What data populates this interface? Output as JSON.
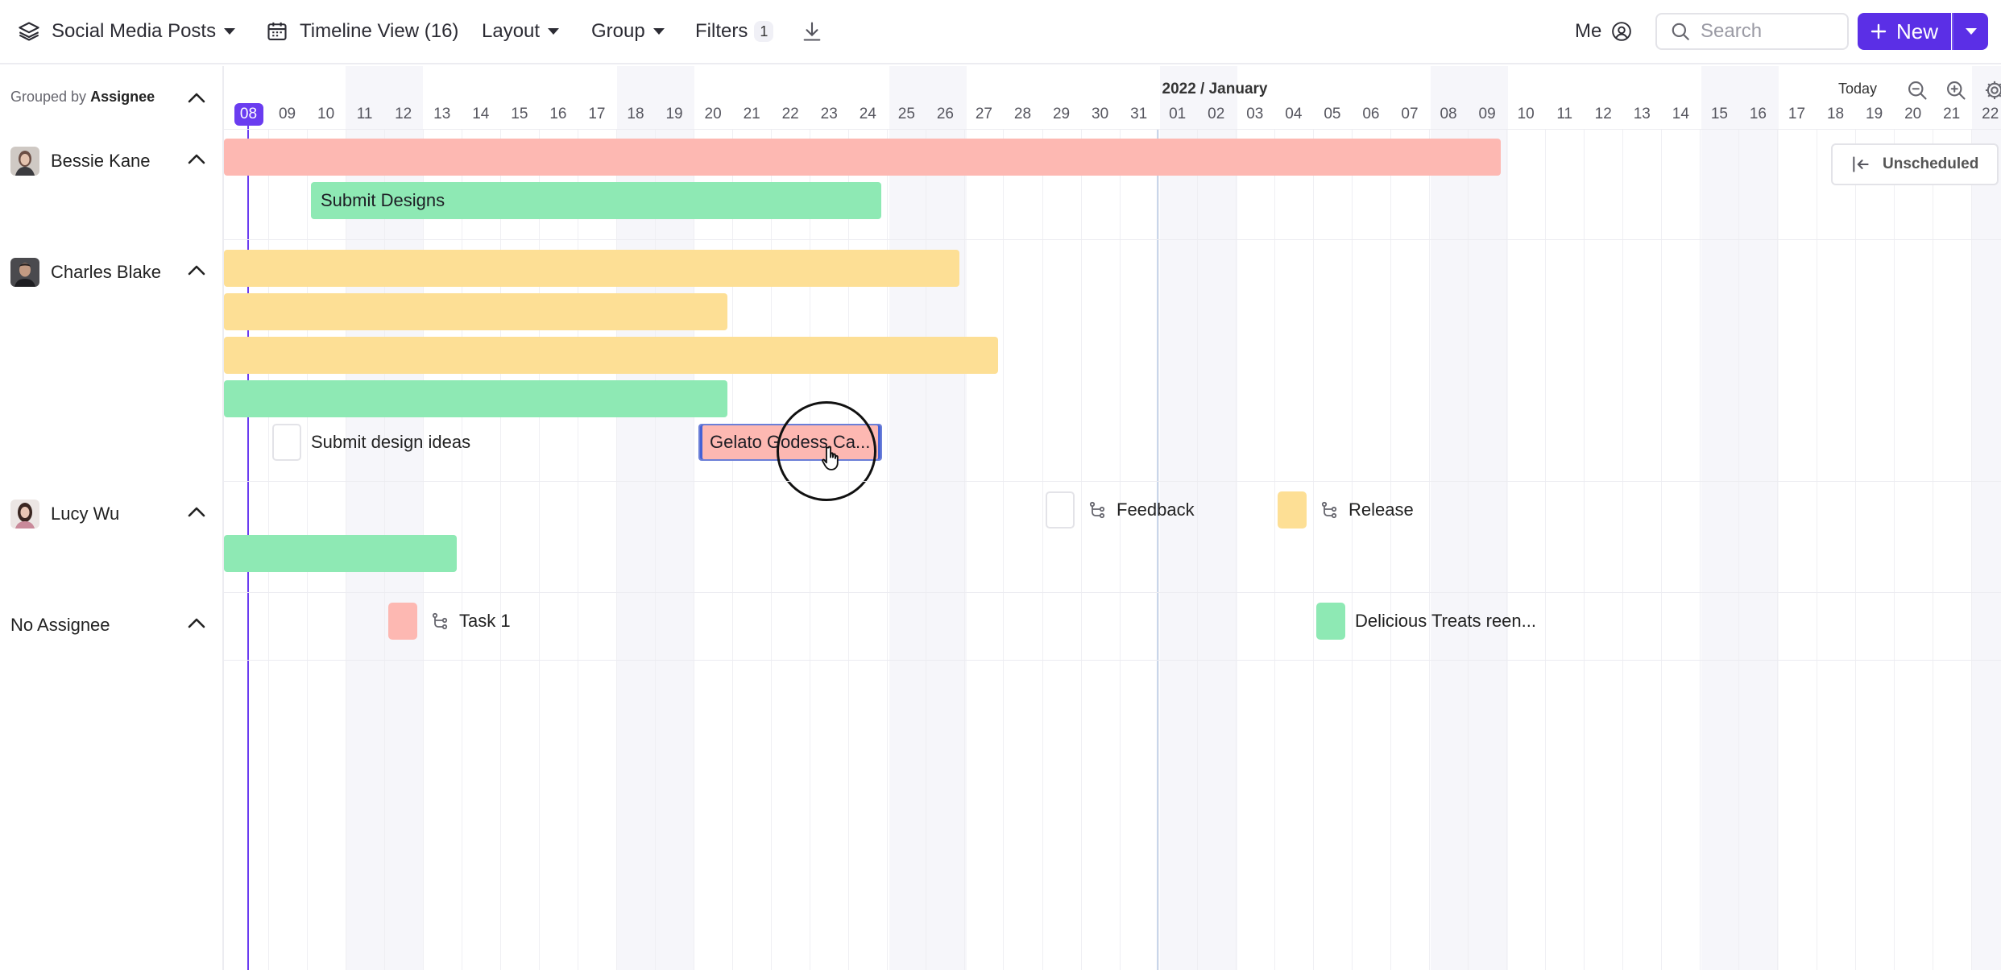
{
  "toolbar": {
    "database_title": "Social Media Posts",
    "view_label": "Timeline View (16)",
    "layout_label": "Layout",
    "group_label": "Group",
    "filters_label": "Filters",
    "filters_count": "1",
    "me_label": "Me",
    "search_placeholder": "Search",
    "new_label": "New"
  },
  "sidebar": {
    "grouped_by_prefix": "Grouped by",
    "grouped_by_field": "Assignee",
    "groups": [
      {
        "name": "Bessie Kane"
      },
      {
        "name": "Charles Blake"
      },
      {
        "name": "Lucy Wu"
      },
      {
        "name": "No Assignee"
      }
    ]
  },
  "timeline": {
    "month_label": "2022 / January",
    "today_label": "Today",
    "unscheduled_label": "Unscheduled",
    "days": [
      "08",
      "09",
      "10",
      "11",
      "12",
      "13",
      "14",
      "15",
      "16",
      "17",
      "18",
      "19",
      "20",
      "21",
      "22",
      "23",
      "24",
      "25",
      "26",
      "27",
      "28",
      "29",
      "30",
      "31",
      "01",
      "02",
      "03",
      "04",
      "05",
      "06",
      "07",
      "08",
      "09",
      "10",
      "11",
      "12",
      "13",
      "14",
      "15",
      "16",
      "17",
      "18",
      "19",
      "20",
      "21",
      "22"
    ],
    "today_day": "08"
  },
  "tasks": {
    "submit_designs": "Submit Designs",
    "submit_design_ideas": "Submit design ideas",
    "gelato": "Gelato Godess Ca...",
    "feedback": "Feedback",
    "release": "Release",
    "task1": "Task 1",
    "delicious": "Delicious Treats reen..."
  },
  "colors": {
    "accent": "#5b2fe6",
    "pink": "#fdb8b2",
    "green": "#8ee9b4",
    "yellow": "#fddf95"
  }
}
